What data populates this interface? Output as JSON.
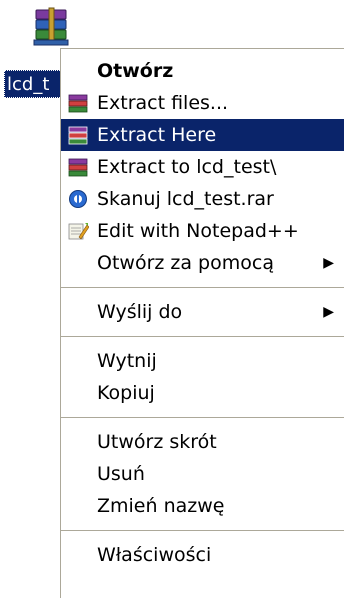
{
  "desktop": {
    "file_icon": "winrar-archive-icon",
    "file_label": "lcd_t"
  },
  "context_menu": {
    "items": [
      {
        "label": "Otwórz",
        "icon": null,
        "bold": true
      },
      {
        "label": "Extract files...",
        "icon": "winrar-books-icon"
      },
      {
        "label": "Extract Here",
        "icon": "winrar-books-icon",
        "highlighted": true
      },
      {
        "label": "Extract to lcd_test\\",
        "icon": "winrar-books-icon"
      },
      {
        "label": "Skanuj lcd_test.rar",
        "icon": "antivirus-scan-icon"
      },
      {
        "label": "Edit with Notepad++",
        "icon": "notepad-plus-plus-icon"
      },
      {
        "label": "Otwórz za pomocą",
        "icon": null,
        "submenu": true
      },
      {
        "label": "Wyślij do",
        "icon": null,
        "submenu": true
      },
      {
        "label": "Wytnij",
        "icon": null
      },
      {
        "label": "Kopiuj",
        "icon": null
      },
      {
        "label": "Utwórz skrót",
        "icon": null
      },
      {
        "label": "Usuń",
        "icon": null
      },
      {
        "label": "Zmień nazwę",
        "icon": null
      },
      {
        "label": "Właściwości",
        "icon": null
      }
    ],
    "submenu_arrow_icon": "submenu-arrow-icon"
  },
  "colors": {
    "highlight": "#0a246a",
    "highlight_text": "#ffffff",
    "separator": "#aca899"
  }
}
